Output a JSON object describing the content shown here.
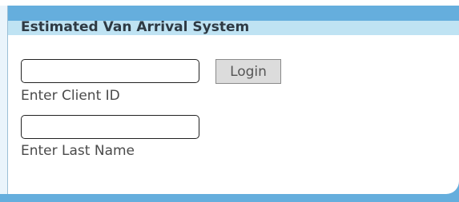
{
  "app": {
    "title": "Estimated Van Arrival System"
  },
  "login_form": {
    "client_id": {
      "value": "",
      "label": "Enter Client ID"
    },
    "last_name": {
      "value": "",
      "label": "Enter Last Name"
    },
    "login_label": "Login"
  },
  "colors": {
    "header_blue": "#65aedd",
    "title_bar": "#bfe3f3",
    "button_gray": "#dcdcdc",
    "text_gray": "#4a4a4a"
  }
}
